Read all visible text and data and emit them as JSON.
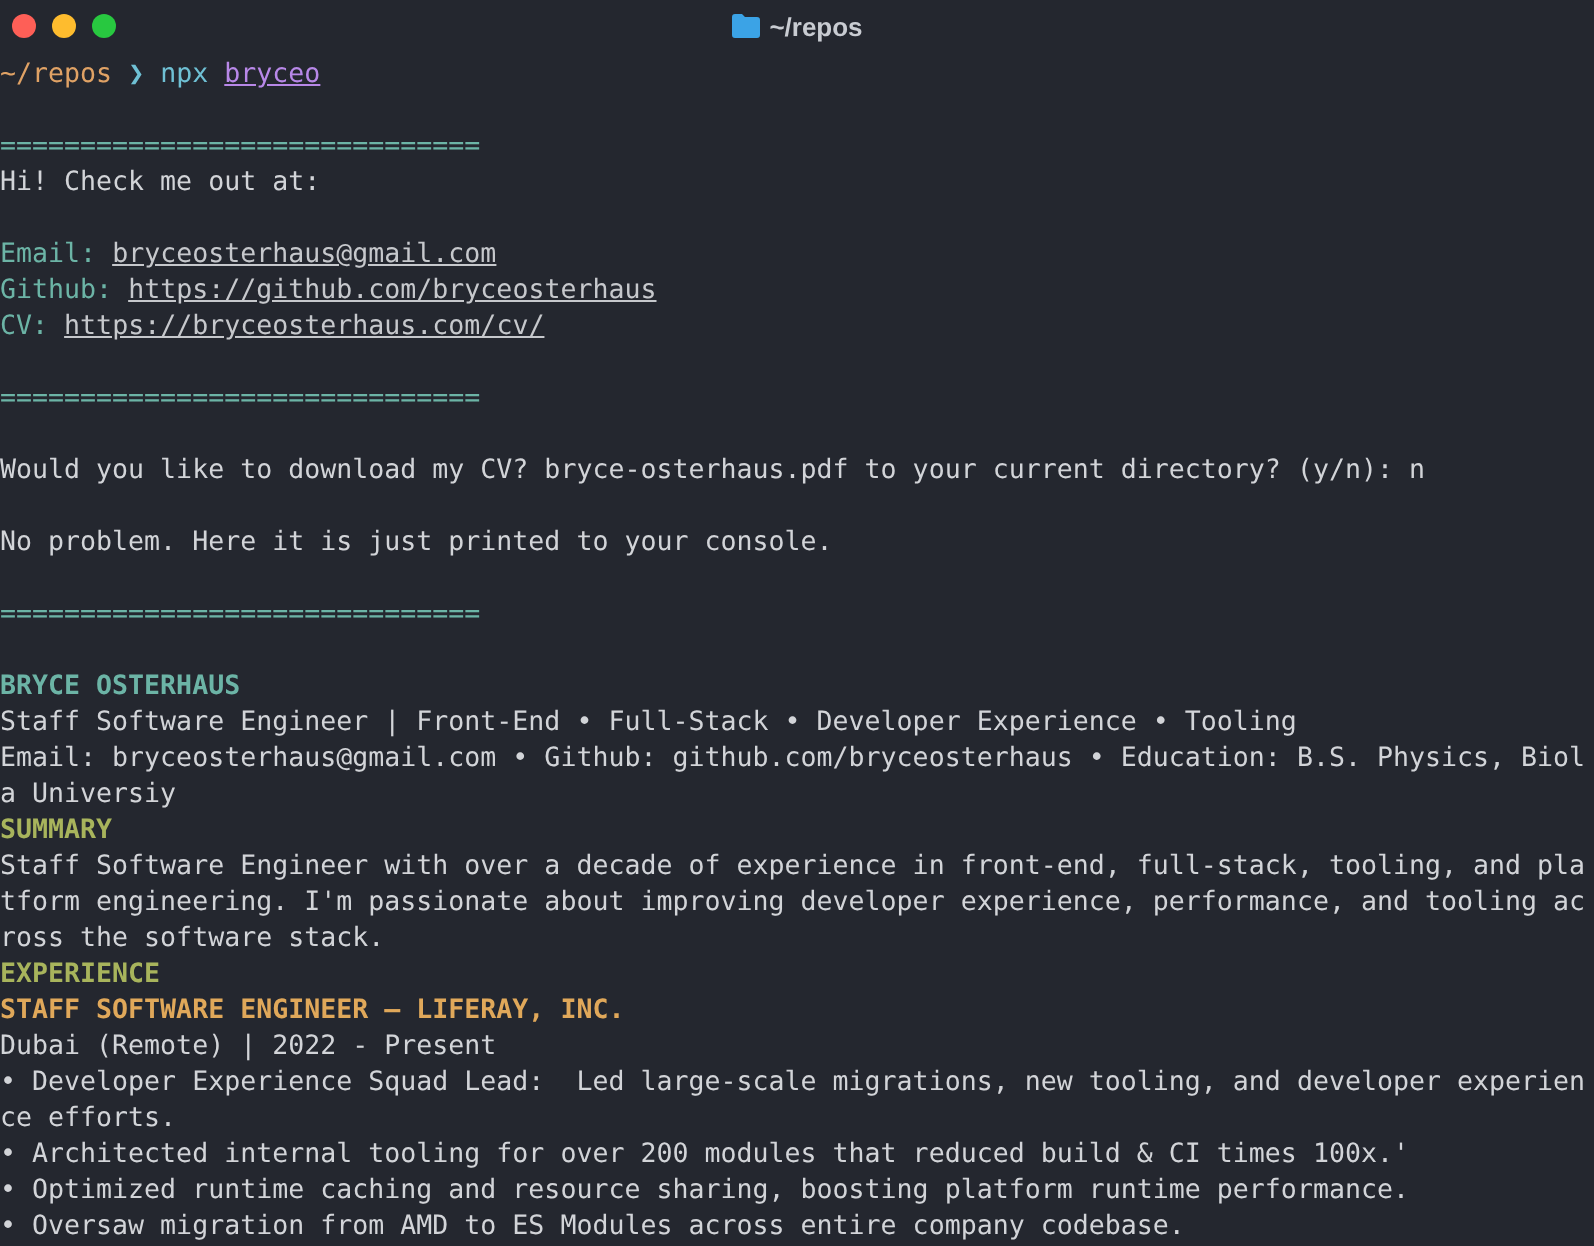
{
  "window": {
    "title": "~/repos"
  },
  "prompt": {
    "path": "~/repos",
    "symbol": "❯",
    "command": "npx",
    "argument": "bryceo"
  },
  "lines": [
    {
      "kind": "blank"
    },
    {
      "kind": "rule",
      "text": "=============================="
    },
    {
      "kind": "text",
      "text": "Hi! Check me out at:"
    },
    {
      "kind": "blank"
    },
    {
      "kind": "link",
      "label": "Email:",
      "link": "bryceosterhaus@gmail.com"
    },
    {
      "kind": "link",
      "label": "Github:",
      "link": "https://github.com/bryceosterhaus"
    },
    {
      "kind": "link",
      "label": "CV:",
      "link": "https://bryceosterhaus.com/cv/"
    },
    {
      "kind": "blank"
    },
    {
      "kind": "rule",
      "text": "=============================="
    },
    {
      "kind": "blank"
    },
    {
      "kind": "text",
      "text": "Would you like to download my CV? bryce-osterhaus.pdf to your current directory? (y/n): n"
    },
    {
      "kind": "blank"
    },
    {
      "kind": "text",
      "text": "No problem. Here it is just printed to your console."
    },
    {
      "kind": "blank"
    },
    {
      "kind": "rule",
      "text": "=============================="
    },
    {
      "kind": "blank"
    },
    {
      "kind": "name",
      "text": "BRYCE OSTERHAUS"
    },
    {
      "kind": "text",
      "text": "Staff Software Engineer | Front-End • Full-Stack • Developer Experience • Tooling"
    },
    {
      "kind": "text",
      "text": "Email: bryceosterhaus@gmail.com • Github: github.com/bryceosterhaus • Education: B.S. Physics, Biol"
    },
    {
      "kind": "text",
      "text": "a Universiy"
    },
    {
      "kind": "section",
      "text": "SUMMARY"
    },
    {
      "kind": "text",
      "text": "Staff Software Engineer with over a decade of experience in front-end, full-stack, tooling, and pla"
    },
    {
      "kind": "text",
      "text": "tform engineering. I'm passionate about improving developer experience, performance, and tooling ac"
    },
    {
      "kind": "text",
      "text": "ross the software stack."
    },
    {
      "kind": "section",
      "text": "EXPERIENCE"
    },
    {
      "kind": "role",
      "text": "STAFF SOFTWARE ENGINEER — LIFERAY, INC."
    },
    {
      "kind": "text",
      "text": "Dubai (Remote) | 2022 - Present"
    },
    {
      "kind": "text",
      "text": "• Developer Experience Squad Lead:  Led large-scale migrations, new tooling, and developer experien"
    },
    {
      "kind": "text",
      "text": "ce efforts."
    },
    {
      "kind": "text",
      "text": "• Architected internal tooling for over 200 modules that reduced build & CI times 100x.'"
    },
    {
      "kind": "text",
      "text": "• Optimized runtime caching and resource sharing, boosting platform runtime performance."
    },
    {
      "kind": "text",
      "text": "• Oversaw migration from AMD to ES Modules across entire company codebase."
    }
  ]
}
